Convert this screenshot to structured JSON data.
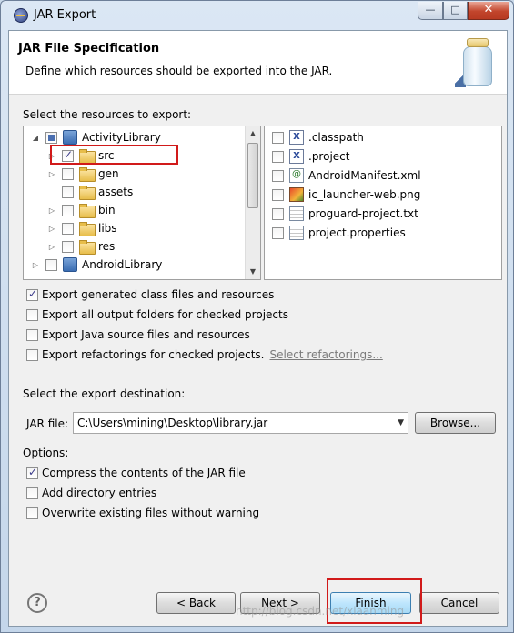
{
  "window": {
    "title": "JAR Export",
    "minimize": "—",
    "maximize": "□",
    "close": "✕"
  },
  "header": {
    "title": "JAR File Specification",
    "description": "Define which resources should be exported into the JAR."
  },
  "resources": {
    "label": "Select the resources to export:",
    "tree": [
      {
        "label": "ActivityLibrary",
        "expander": "◢",
        "state": "partial",
        "icon": "project-icon",
        "highlighted": false
      },
      {
        "label": "src",
        "expander": "▷",
        "state": "checked",
        "icon": "package-folder-icon",
        "highlighted": true
      },
      {
        "label": "gen",
        "expander": "▷",
        "state": "unchecked",
        "icon": "package-folder-icon",
        "highlighted": false
      },
      {
        "label": "assets",
        "expander": "",
        "state": "unchecked",
        "icon": "folder-icon",
        "highlighted": false
      },
      {
        "label": "bin",
        "expander": "▷",
        "state": "unchecked",
        "icon": "folder-icon",
        "highlighted": false
      },
      {
        "label": "libs",
        "expander": "▷",
        "state": "unchecked",
        "icon": "folder-icon",
        "highlighted": false
      },
      {
        "label": "res",
        "expander": "▷",
        "state": "unchecked",
        "icon": "folder-icon",
        "highlighted": false
      },
      {
        "label": "AndroidLibrary",
        "expander": "▷",
        "state": "unchecked",
        "icon": "project-icon",
        "highlighted": false
      }
    ],
    "files": [
      {
        "label": ".classpath",
        "icon": "xml-file-icon"
      },
      {
        "label": ".project",
        "icon": "xml-file-icon"
      },
      {
        "label": "AndroidManifest.xml",
        "icon": "manifest-file-icon"
      },
      {
        "label": "ic_launcher-web.png",
        "icon": "image-file-icon"
      },
      {
        "label": "proguard-project.txt",
        "icon": "text-file-icon"
      },
      {
        "label": "project.properties",
        "icon": "text-file-icon"
      }
    ]
  },
  "export_options": [
    {
      "label": "Export generated class files and resources",
      "checked": true
    },
    {
      "label": "Export all output folders for checked projects",
      "checked": false
    },
    {
      "label": "Export Java source files and resources",
      "checked": false
    },
    {
      "label": "Export refactorings for checked projects.",
      "checked": false,
      "link": "Select refactorings..."
    }
  ],
  "destination": {
    "label": "Select the export destination:",
    "jar_label": "JAR file:",
    "jar_value": "C:\\Users\\mining\\Desktop\\library.jar",
    "browse": "Browse..."
  },
  "options": {
    "label": "Options:",
    "items": [
      {
        "label": "Compress the contents of the JAR file",
        "checked": true
      },
      {
        "label": "Add directory entries",
        "checked": false
      },
      {
        "label": "Overwrite existing files without warning",
        "checked": false
      }
    ]
  },
  "footer": {
    "help": "?",
    "back": "< Back",
    "next": "Next >",
    "finish": "Finish",
    "cancel": "Cancel",
    "watermark": "http://blog.csdn.net/xiaanming"
  },
  "colors": {
    "highlight_box": "#d11a1a",
    "title_bg": "#dbe7f4"
  }
}
